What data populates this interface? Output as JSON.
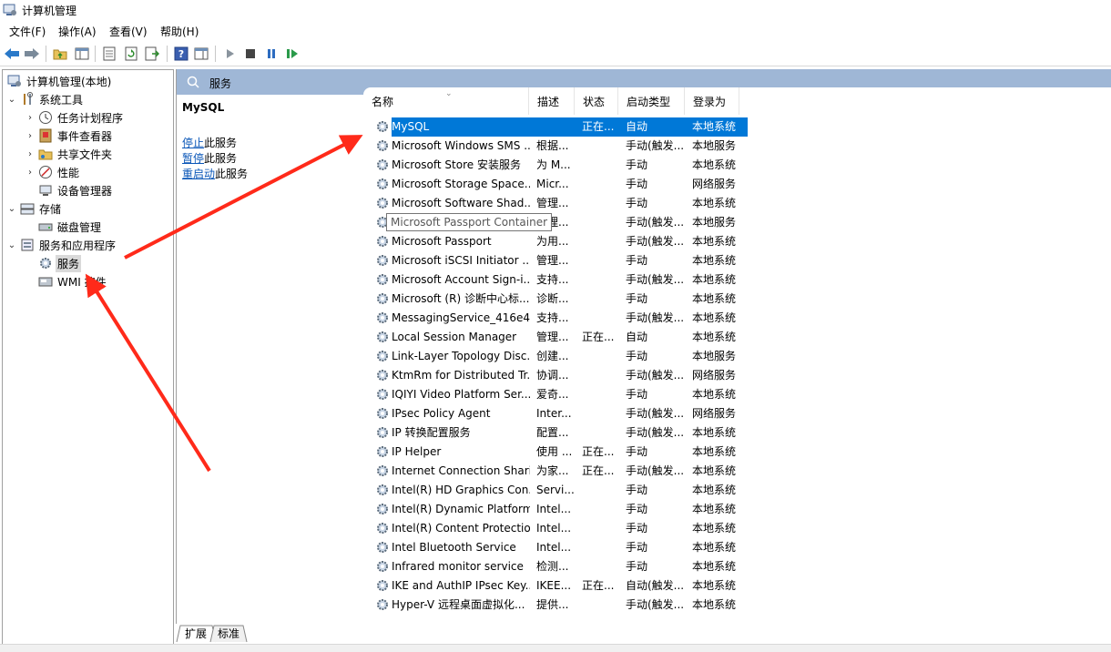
{
  "window": {
    "title": "计算机管理"
  },
  "menu": [
    "文件(F)",
    "操作(A)",
    "查看(V)",
    "帮助(H)"
  ],
  "tree": {
    "root": "计算机管理(本地)",
    "system_tools": "系统工具",
    "task_scheduler": "任务计划程序",
    "event_viewer": "事件查看器",
    "shared_folders": "共享文件夹",
    "performance": "性能",
    "device_manager": "设备管理器",
    "storage": "存储",
    "disk_management": "磁盘管理",
    "services_apps": "服务和应用程序",
    "services": "服务",
    "wmi": "WMI 控件"
  },
  "header": {
    "title": "服务"
  },
  "desc": {
    "service_name": "MySQL",
    "stop_link": "停止",
    "stop_suffix": "此服务",
    "pause_link": "暂停",
    "pause_suffix": "此服务",
    "restart_link": "重启动",
    "restart_suffix": "此服务"
  },
  "columns": [
    "名称",
    "描述",
    "状态",
    "启动类型",
    "登录为"
  ],
  "tooltip": "Microsoft Passport Container",
  "rows": [
    {
      "name": "MySQL",
      "desc": "",
      "status": "正在...",
      "startup": "自动",
      "logon": "本地系统"
    },
    {
      "name": "Microsoft Windows SMS ...",
      "desc": "根据...",
      "status": "",
      "startup": "手动(触发...",
      "logon": "本地服务"
    },
    {
      "name": "Microsoft Store 安装服务",
      "desc": "为 M...",
      "status": "",
      "startup": "手动",
      "logon": "本地系统"
    },
    {
      "name": "Microsoft Storage Space...",
      "desc": "Micr...",
      "status": "",
      "startup": "手动",
      "logon": "网络服务"
    },
    {
      "name": "Microsoft Software Shad...",
      "desc": "管理...",
      "status": "",
      "startup": "手动",
      "logon": "本地系统"
    },
    {
      "name": "Microsoft Passport Container",
      "desc": "管理...",
      "status": "",
      "startup": "手动(触发...",
      "logon": "本地服务"
    },
    {
      "name": "Microsoft Passport",
      "desc": "为用...",
      "status": "",
      "startup": "手动(触发...",
      "logon": "本地系统"
    },
    {
      "name": "Microsoft iSCSI Initiator ...",
      "desc": "管理...",
      "status": "",
      "startup": "手动",
      "logon": "本地系统"
    },
    {
      "name": "Microsoft Account Sign-i...",
      "desc": "支持...",
      "status": "",
      "startup": "手动(触发...",
      "logon": "本地系统"
    },
    {
      "name": "Microsoft (R) 诊断中心标...",
      "desc": "诊断...",
      "status": "",
      "startup": "手动",
      "logon": "本地系统"
    },
    {
      "name": "MessagingService_416e4",
      "desc": "支持...",
      "status": "",
      "startup": "手动(触发...",
      "logon": "本地系统"
    },
    {
      "name": "Local Session Manager",
      "desc": "管理...",
      "status": "正在...",
      "startup": "自动",
      "logon": "本地系统"
    },
    {
      "name": "Link-Layer Topology Disc...",
      "desc": "创建...",
      "status": "",
      "startup": "手动",
      "logon": "本地服务"
    },
    {
      "name": "KtmRm for Distributed Tr...",
      "desc": "协调...",
      "status": "",
      "startup": "手动(触发...",
      "logon": "网络服务"
    },
    {
      "name": "IQIYI Video Platform Ser...",
      "desc": "爱奇...",
      "status": "",
      "startup": "手动",
      "logon": "本地系统"
    },
    {
      "name": "IPsec Policy Agent",
      "desc": "Inter...",
      "status": "",
      "startup": "手动(触发...",
      "logon": "网络服务"
    },
    {
      "name": "IP 转换配置服务",
      "desc": "配置...",
      "status": "",
      "startup": "手动(触发...",
      "logon": "本地系统"
    },
    {
      "name": "IP Helper",
      "desc": "使用 ...",
      "status": "正在...",
      "startup": "手动",
      "logon": "本地系统"
    },
    {
      "name": "Internet Connection Shari...",
      "desc": "为家...",
      "status": "正在...",
      "startup": "手动(触发...",
      "logon": "本地系统"
    },
    {
      "name": "Intel(R) HD Graphics Con...",
      "desc": "Servi...",
      "status": "",
      "startup": "手动",
      "logon": "本地系统"
    },
    {
      "name": "Intel(R) Dynamic Platform...",
      "desc": "Intel...",
      "status": "",
      "startup": "手动",
      "logon": "本地系统"
    },
    {
      "name": "Intel(R) Content Protectio...",
      "desc": "Intel...",
      "status": "",
      "startup": "手动",
      "logon": "本地系统"
    },
    {
      "name": "Intel Bluetooth Service",
      "desc": "Intel...",
      "status": "",
      "startup": "手动",
      "logon": "本地系统"
    },
    {
      "name": "Infrared monitor service",
      "desc": "检测...",
      "status": "",
      "startup": "手动",
      "logon": "本地系统"
    },
    {
      "name": "IKE and AuthIP IPsec Key...",
      "desc": "IKEE...",
      "status": "正在...",
      "startup": "自动(触发...",
      "logon": "本地系统"
    },
    {
      "name": "Hyper-V 远程桌面虚拟化...",
      "desc": "提供...",
      "status": "",
      "startup": "手动(触发...",
      "logon": "本地系统"
    }
  ],
  "tabs": [
    "扩展",
    "标准"
  ],
  "colors": {
    "selection": "#0078d7",
    "header_bar": "#9fb7d6",
    "link": "#0b57b8",
    "annotation_arrow": "#ff2a1a"
  }
}
